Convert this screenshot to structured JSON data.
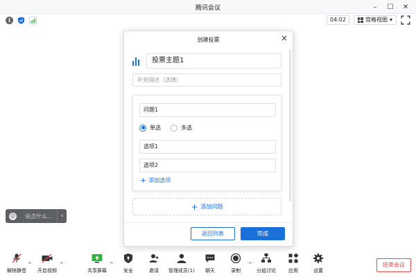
{
  "window": {
    "title": "腾讯会议"
  },
  "status": {
    "timer": "04:02",
    "view_label": "宫格视图"
  },
  "dialog": {
    "title": "创建投票",
    "topic_value": "投票主题1",
    "description_placeholder": "补充描述（选填）",
    "question": {
      "title_value": "问题1",
      "single_label": "单选",
      "multi_label": "多选",
      "selected": "单选",
      "options": [
        "选项1",
        "选项2"
      ],
      "add_option_label": "添加选项"
    },
    "add_question_label": "添加问题",
    "back_label": "返回列表",
    "done_label": "完成"
  },
  "chat": {
    "placeholder": "说点什么..."
  },
  "toolbar": {
    "items": [
      {
        "label": "解除静音",
        "icon": "mic-muted-icon"
      },
      {
        "label": "开启视频",
        "icon": "camera-off-icon"
      },
      {
        "label": "共享屏幕",
        "icon": "share-screen-icon"
      },
      {
        "label": "安全",
        "icon": "shield-icon"
      },
      {
        "label": "邀请",
        "icon": "invite-icon"
      },
      {
        "label": "管理成员(1)",
        "icon": "members-icon"
      },
      {
        "label": "聊天",
        "icon": "chat-icon"
      },
      {
        "label": "录制",
        "icon": "record-icon"
      },
      {
        "label": "分组讨论",
        "icon": "breakout-icon"
      },
      {
        "label": "应用",
        "icon": "apps-icon"
      },
      {
        "label": "设置",
        "icon": "gear-icon"
      }
    ],
    "end_label": "结束会议"
  },
  "colors": {
    "accent": "#1b6fd8",
    "danger": "#e04a4a",
    "signal": "#2fb344"
  }
}
